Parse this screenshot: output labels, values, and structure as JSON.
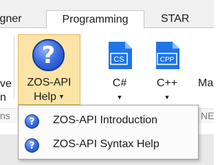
{
  "tabs": [
    {
      "label": "igner"
    },
    {
      "label": "Programming"
    },
    {
      "label": "STAR"
    }
  ],
  "partial": {
    "left_line1": "ve",
    "left_line2": "n",
    "left_group": "ns",
    "right_button": "Ma",
    "right_group": "NE"
  },
  "help_button": {
    "line1": "ZOS-API",
    "line2": "Help",
    "caret": "▼",
    "icon_glyph": "?"
  },
  "code_buttons": [
    {
      "icon_text": "CS",
      "label": "C#",
      "caret": "▼"
    },
    {
      "icon_text": "CPP",
      "label": "C++",
      "caret": "▼"
    }
  ],
  "menu": {
    "items": [
      {
        "label": "ZOS-API Introduction",
        "icon_glyph": "?"
      },
      {
        "label": "ZOS-API Syntax Help",
        "icon_glyph": "?"
      }
    ]
  },
  "colors": {
    "accent_blue": "#1f75e6",
    "highlight": "#fbe4a6"
  }
}
